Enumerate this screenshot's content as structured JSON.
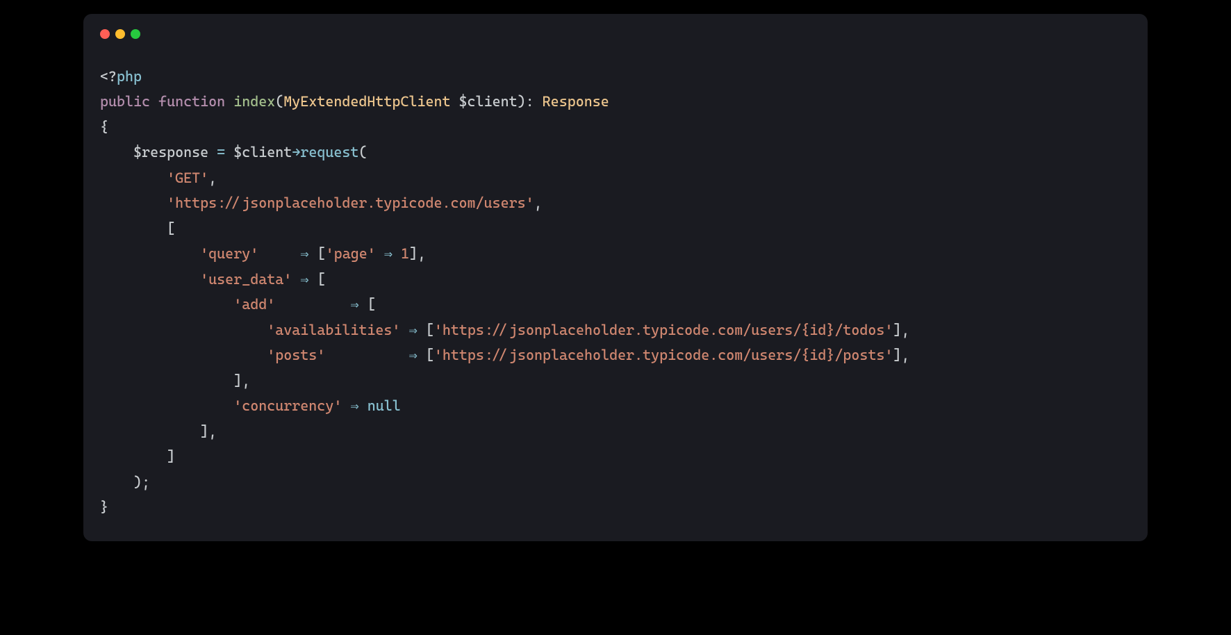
{
  "tokens": {
    "open_lt": "<",
    "open_qm": "?",
    "php": "php",
    "public": "public",
    "function": "function",
    "index": "index",
    "lparen": "(",
    "type_client": "MyExtendedHttpClient",
    "var_client": "$client",
    "rparen": ")",
    "colon": ":",
    "ret_type": "Response",
    "lbrace": "{",
    "var_response": "$response",
    "eq": "=",
    "arrow": "→",
    "method": "request",
    "darrow": "⇒",
    "comma": ",",
    "semi": ";",
    "rbrace": "}",
    "lbrack": "[",
    "rbrack": "]",
    "num_1": "1",
    "null": "null",
    "str_get": "'GET'",
    "str_users": "'https://jsonplaceholder.typicode.com/users'",
    "str_query": "'query'",
    "str_page": "'page'",
    "str_user_data": "'user_data'",
    "str_add": "'add'",
    "str_avail": "'availabilities'",
    "str_todos_url": "'https://jsonplaceholder.typicode.com/users/{id}/todos'",
    "str_posts": "'posts'",
    "str_posts_url": "'https://jsonplaceholder.typicode.com/users/{id}/posts'",
    "str_concurrency": "'concurrency'"
  }
}
